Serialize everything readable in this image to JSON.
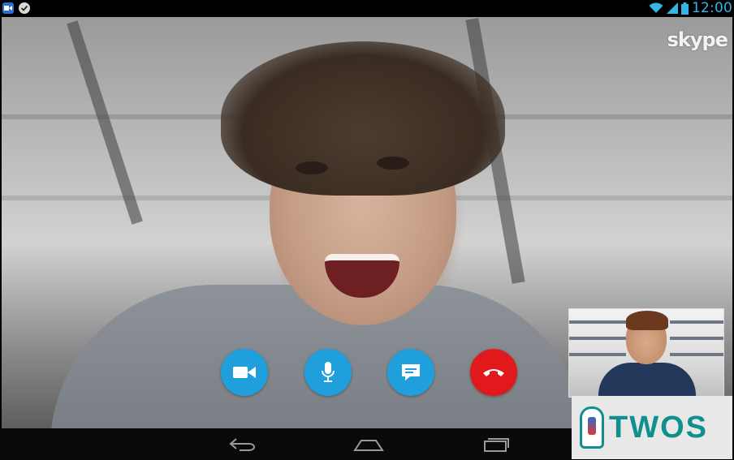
{
  "status_bar": {
    "time": "12:00",
    "notifications": [
      "video-call-icon",
      "check-icon"
    ],
    "indicators": [
      "wifi-icon",
      "signal-icon",
      "battery-icon"
    ],
    "accent": "#33b5e5"
  },
  "call": {
    "app_logo": "skype",
    "controls": [
      {
        "name": "video-toggle-button",
        "icon": "video-camera-icon",
        "color": "#1fa0dd"
      },
      {
        "name": "mic-toggle-button",
        "icon": "microphone-icon",
        "color": "#1fa0dd"
      },
      {
        "name": "chat-button",
        "icon": "chat-bubble-icon",
        "color": "#1fa0dd"
      },
      {
        "name": "end-call-button",
        "icon": "hang-up-icon",
        "color": "#e1191d"
      }
    ]
  },
  "watermark": {
    "text": "TWOS",
    "color": "#0f8f8d"
  },
  "nav_bar": {
    "buttons": [
      "back-icon",
      "home-icon",
      "recent-apps-icon"
    ]
  }
}
